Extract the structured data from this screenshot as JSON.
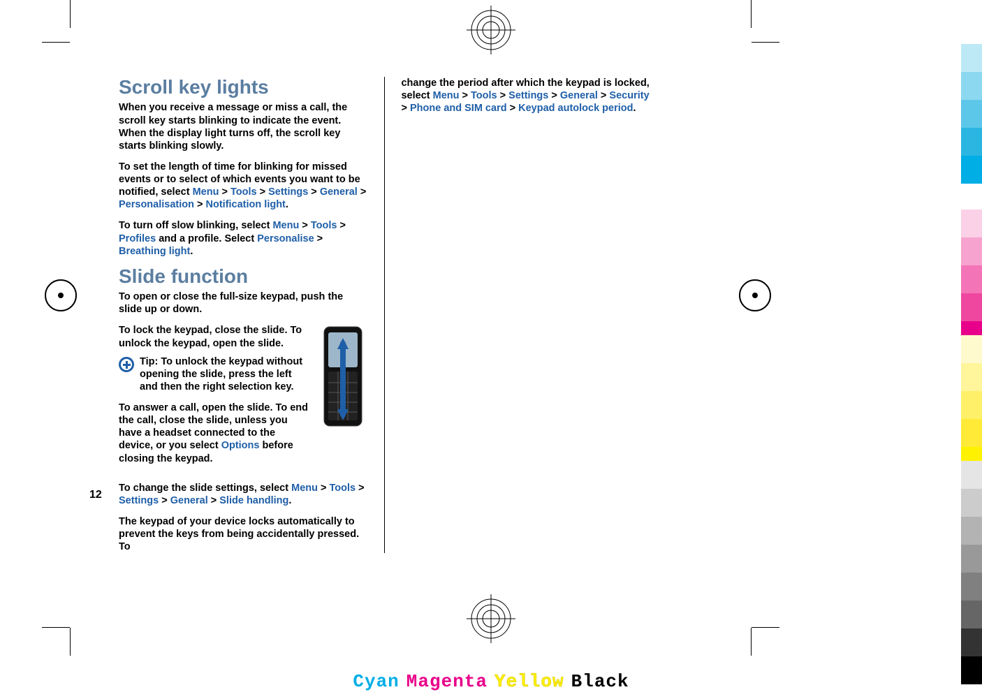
{
  "page_number": "12",
  "headings": {
    "scroll_key_lights": "Scroll key lights",
    "slide_function": "Slide function"
  },
  "paragraphs": {
    "skl_intro": "When you receive a message or miss a call, the scroll key starts blinking to indicate the event. When the display light turns off, the scroll key starts blinking slowly.",
    "skl_set_prefix": "To set the length of time for blinking for missed events or to select of which events you want to be notified, select ",
    "skl_turn_off_prefix": "To turn off slow blinking, select ",
    "skl_turn_off_middle": " and a profile. Select ",
    "slide_open": "To open or close the full-size keypad, push the slide up or down.",
    "slide_lock": "To lock the keypad, close the slide. To unlock the keypad, open the slide.",
    "tip_label": "Tip: ",
    "tip_body": "To unlock the keypad without opening the slide, press the left and then the right selection key.",
    "slide_answer_prefix": "To answer a call, open the slide. To end the call, close the slide, unless you have a headset connected to the device, or you select ",
    "slide_answer_suffix": " before closing the keypad.",
    "slide_change_prefix": "To change the slide settings, select ",
    "slide_autolock": "The keypad of your device locks automatically to prevent the keys from being accidentally pressed. To",
    "col2_prefix": "change the period after which the keypad is locked, select "
  },
  "links": {
    "menu": "Menu",
    "tools": "Tools",
    "settings": "Settings",
    "general": "General",
    "personalisation": "Personalisation",
    "notification_light": "Notification light",
    "profiles": "Profiles",
    "personalise": "Personalise",
    "breathing_light": "Breathing light",
    "options": "Options",
    "slide_handling": "Slide handling",
    "security": "Security",
    "phone_and_sim": "Phone and SIM card",
    "keypad_autolock_period": "Keypad autolock period"
  },
  "sep": " > ",
  "period": ".",
  "cmyk": {
    "cyan": "Cyan",
    "magenta": "Magenta",
    "yellow": "Yellow",
    "black": "Black"
  },
  "swatches": {
    "cyan": [
      "#bde9f7",
      "#8cd8f0",
      "#5cc7e9",
      "#2bb6e2",
      "#00aee6"
    ],
    "magenta": [
      "#fbd1e7",
      "#f7a3cf",
      "#f375b7",
      "#ef479f",
      "#e8008a"
    ],
    "yellow": [
      "#fffacd",
      "#fff59b",
      "#fff069",
      "#ffeb37",
      "#fff200"
    ],
    "grey": [
      "#e5e5e5",
      "#cccccc",
      "#b3b3b3",
      "#999999",
      "#808080",
      "#666666",
      "#333333",
      "#000000"
    ]
  }
}
